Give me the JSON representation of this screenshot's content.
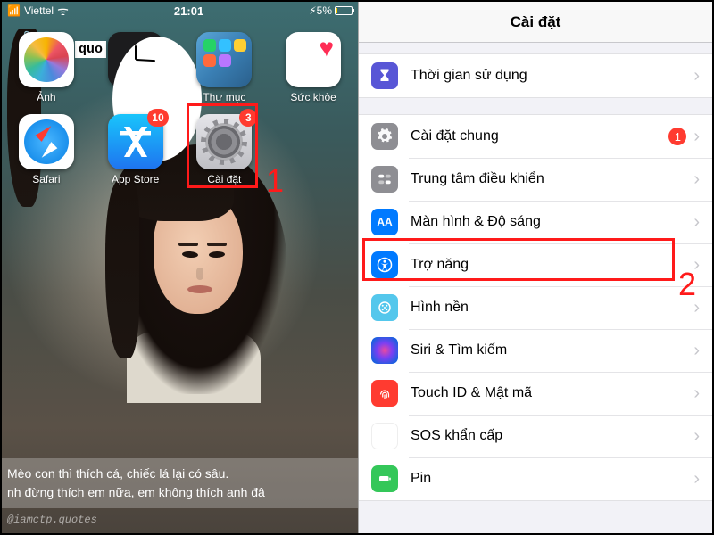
{
  "status": {
    "carrier": "Viettel",
    "time": "21:01",
    "battery_pct": "5%"
  },
  "quo_badge": "quo",
  "apps_row1": [
    {
      "label": "Ảnh"
    },
    {
      "label": "Đồng hồ"
    },
    {
      "label": "Thư mục"
    },
    {
      "label": "Sức khỏe"
    }
  ],
  "apps_row2": [
    {
      "label": "Safari",
      "badge": null
    },
    {
      "label": "App Store",
      "badge": "10"
    },
    {
      "label": "Cài đặt",
      "badge": "3"
    }
  ],
  "quote_line1": "Mèo con thì thích cá, chiếc lá lại có sâu.",
  "quote_line2": "nh đừng thích em nữa, em không thích anh đâ",
  "watermark": "@iamctp.quotes",
  "annotations": {
    "left_num": "1",
    "right_num": "2"
  },
  "settings": {
    "title": "Cài đặt",
    "grp0": [
      {
        "key": "screentime",
        "label": "Thời gian sử dụng"
      }
    ],
    "grp1": [
      {
        "key": "general",
        "label": "Cài đặt chung",
        "badge": "1"
      },
      {
        "key": "controlcenter",
        "label": "Trung tâm điều khiển"
      },
      {
        "key": "display",
        "label": "Màn hình & Độ sáng"
      },
      {
        "key": "accessibility",
        "label": "Trợ năng"
      },
      {
        "key": "wallpaper",
        "label": "Hình nền"
      },
      {
        "key": "siri",
        "label": "Siri & Tìm kiếm"
      },
      {
        "key": "touchid",
        "label": "Touch ID & Mật mã"
      },
      {
        "key": "sos",
        "label": "SOS khẩn cấp"
      },
      {
        "key": "battery",
        "label": "Pin"
      }
    ]
  }
}
